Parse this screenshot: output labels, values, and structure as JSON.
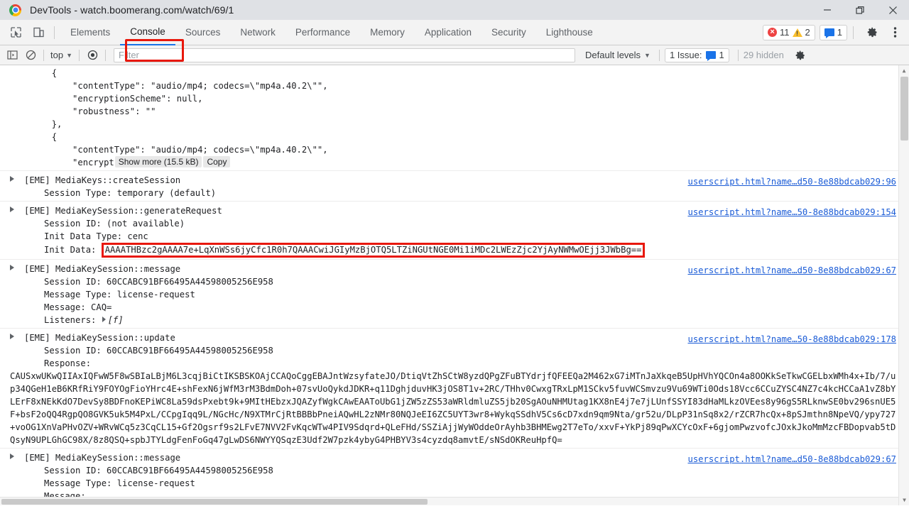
{
  "window": {
    "title": "DevTools - watch.boomerang.com/watch/69/1",
    "logo_icon": "chrome-logo-icon",
    "controls": [
      {
        "name": "minimize",
        "icon": "minimize-icon"
      },
      {
        "name": "maximize",
        "icon": "maximize-icon"
      },
      {
        "name": "close",
        "icon": "close-icon"
      }
    ]
  },
  "toolbar": {
    "inspect_icon": "inspect-element-icon",
    "device_icon": "device-toolbar-icon",
    "tabs": [
      {
        "label": "Elements",
        "selected": false
      },
      {
        "label": "Console",
        "selected": true
      },
      {
        "label": "Sources",
        "selected": false
      },
      {
        "label": "Network",
        "selected": false
      },
      {
        "label": "Performance",
        "selected": false
      },
      {
        "label": "Memory",
        "selected": false
      },
      {
        "label": "Application",
        "selected": false
      },
      {
        "label": "Security",
        "selected": false
      },
      {
        "label": "Lighthouse",
        "selected": false
      }
    ],
    "error_count": "11",
    "warning_count": "2",
    "message_count": "1",
    "settings_icon": "gear-icon",
    "more_icon": "more-vertical-icon",
    "highlight_color": "#e8180c",
    "accent_color": "#1a73e8"
  },
  "filterbar": {
    "sidebar_icon": "show-console-sidebar-icon",
    "clear_icon": "clear-console-icon",
    "context": "top",
    "eye_icon": "live-expression-icon",
    "filter_value": "",
    "filter_placeholder": "Filter",
    "levels_label": "Default levels",
    "issues_label": "1 Issue:",
    "issues_count": "1",
    "hidden_label": "29 hidden",
    "gear_icon": "console-settings-gear-icon"
  },
  "console": {
    "json_preview": {
      "l1": "        {",
      "l2": "            \"contentType\": \"audio/mp4; codecs=\\\"mp4a.40.2\\\"\",",
      "l3": "            \"encryptionScheme\": null,",
      "l4": "            \"robustness\": \"\"",
      "l5": "        },",
      "l6": "        {",
      "l7": "            \"contentType\": \"audio/mp4; codecs=\\\"mp4a.40.2\\\"\",",
      "l8_prefix": "            \"encrypt",
      "show_more_label": "Show more (15.5 kB)",
      "copy_label": "Copy"
    },
    "entries": [
      {
        "title": "[EME] MediaKeys::createSession",
        "source": "userscript.html?name…d50-8e88bdcab029:96",
        "details": [
          {
            "text": "Session Type: temporary (default)"
          }
        ]
      },
      {
        "title": "[EME] MediaKeySession::generateRequest",
        "source": "userscript.html?name…50-8e88bdcab029:154",
        "details": [
          {
            "text": "Session ID: (not available)"
          },
          {
            "text": "Init Data Type: cenc"
          },
          {
            "label": "Init Data: ",
            "highlighted": "AAAATHBzc2gAAAA7e+LqXnWSs6jyCfc1R0h7QAAACwiJGIyMzBjOTQ5LTZiNGUtNGE0Mi1iMDc2LWEzZjc2YjAyNWMwOEjj3JWbBg=="
          }
        ]
      },
      {
        "title": "[EME] MediaKeySession::message",
        "source": "userscript.html?name…d50-8e88bdcab029:67",
        "details": [
          {
            "text": "Session ID: 60CCABC91BF66495A44598005256E958"
          },
          {
            "text": "Message Type: license-request"
          },
          {
            "text": "Message: CAQ="
          },
          {
            "label": "Listeners: ",
            "fn": "[f]"
          }
        ]
      },
      {
        "title": "[EME] MediaKeySession::update",
        "source": "userscript.html?name…50-8e88bdcab029:178",
        "details": [
          {
            "text": "Session ID: 60CCABC91BF66495A44598005256E958"
          },
          {
            "text": "Response:"
          }
        ],
        "response_blob": "CAUSxwUKwQIIAxIQFwW5F8wSBIaLBjM6L3cqjBiCtIKSBSKOAjCCAQoCggEBAJntWzsyfateJO/DtiqVtZhSCtW8yzdQPgZFuBTYdrjfQFEEQa2M462xG7iMTnJaXkqeB5UpHVhYQCOn4a8OOKkSeTkwCGELbxWMh4x+Ib/7/up34QGeH1eB6KRfRiY9FOYOgFioYHrc4E+shFexN6jWfM3rM3BdmDoh+07svUoQykdJDKR+q11DghjduvHK3jOS8T1v+2RC/THhv0CwxgTRxLpM1SCkv5fuvWCSmvzu9Vu69WTi0Ods18Vcc6CCuZYSC4NZ7c4kcHCCaA1vZ8bYLErF8xNEkKdO7DevSy8BDFnoKEPiWC8La59dsPxebt9k+9MItHEbzxJQAZyfWgkCAwEAAToUbG1jZW5zZS53aWRldmluZS5jb20SgAOuNHMUtag1KX8nE4j7e7jLUnfSSYI83dHaMLkzOVEes8y96gS5RLknwSE0bv296snUE5F+bsF2oQQ4RgpQO8GVK5uk5M4PxL/CCpgIqq9L/NGcHc/N9XTMrCjRtBBBbPneiAQwHL2zNMr80NQJeEI6ZC5UYT3wr8+WykqSSdhV5Cs6cD7xdn9qm9Nta/gr52u/DLpP31nSq8x2/rZCR7hcQx+8pSJmthn8NpeVQ/ypy727+voOG1XnVaPHvOZV+WRvWCq5z3CqCL15+Gf2Ogsrf9s2LFvE7NVV2FvKqcWTw4PIV9Sdqrd+QLeFHd/SSZiAjjWyWOddeOrAyhb3BHMEwg2T7eTo/xxvF+YkPj89qPwXCYcOxF+6gjomPwzvofcJOxkJkoMmMzcFBDopvab5tDQsyN9UPLGhGC98X/8z8QSQ+spbJTYLdgFenFoGq47gLwDS6NWYYQSqzE3Udf2W7pzk4ybyG4PHBYV3s4cyzdq8amvtE/sNSdOKReuHpfQ=",
        "source_extra": null
      },
      {
        "title": "[EME] MediaKeySession::message",
        "source": "userscript.html?name…d50-8e88bdcab029:67",
        "details": [
          {
            "text": "Session ID: 60CCABC91BF66495A44598005256E958"
          },
          {
            "text": "Message Type: license-request"
          },
          {
            "text": "Message:"
          }
        ]
      }
    ]
  }
}
